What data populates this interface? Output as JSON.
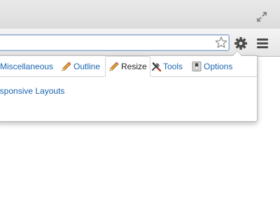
{
  "colors": {
    "link": "#1a64b0",
    "active_tab_text": "#222222"
  },
  "titlebar": {
    "fullscreen_icon": "fullscreen-arrows-icon"
  },
  "toolbar": {
    "omnibox_value": "",
    "star_icon": "bookmark-star-icon",
    "gear_icon": "gear-icon",
    "menu_icon": "hamburger-menu-icon"
  },
  "popup": {
    "tabs": [
      {
        "label": "Miscellaneous",
        "icon": null
      },
      {
        "label": "Outline",
        "icon": "pencil-icon"
      },
      {
        "label": "Resize",
        "icon": "pencil-icon",
        "active": true
      },
      {
        "label": "Tools",
        "icon": "tools-icon"
      },
      {
        "label": "Options",
        "icon": "switch-icon"
      }
    ],
    "content": {
      "link_text": "esponsive Layouts"
    }
  }
}
